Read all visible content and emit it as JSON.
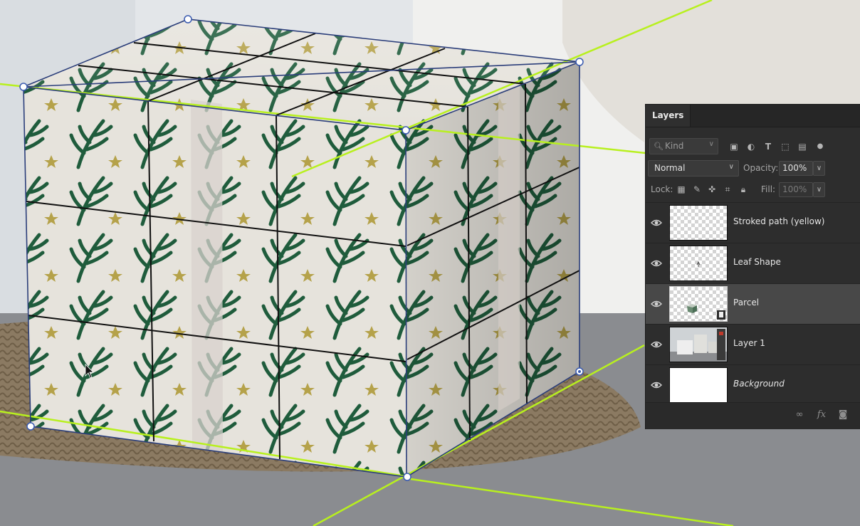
{
  "panel": {
    "title": "Layers",
    "filter": {
      "placeholder": "Kind",
      "icons": [
        "image-filter-icon",
        "adjustment-filter-icon",
        "type-filter-icon",
        "shape-filter-icon",
        "smart-object-filter-icon",
        "filter-toggle-icon"
      ]
    },
    "blend_mode": "Normal",
    "opacity_label": "Opacity:",
    "opacity_value": "100%",
    "lock_label": "Lock:",
    "lock_icons": [
      "lock-transparent-pixels-icon",
      "lock-image-pixels-icon",
      "lock-position-icon",
      "lock-artboard-icon",
      "lock-all-icon"
    ],
    "fill_label": "Fill:",
    "fill_value": "100%",
    "layers": [
      {
        "name": "Stroked path (yellow)",
        "visible": true,
        "selected": false,
        "thumb": "transparent"
      },
      {
        "name": "Leaf Shape",
        "visible": true,
        "selected": false,
        "thumb": "transparent-leaf"
      },
      {
        "name": "Parcel",
        "visible": true,
        "selected": true,
        "thumb": "smart-object-cube"
      },
      {
        "name": "Layer 1",
        "visible": true,
        "selected": false,
        "thumb": "photo"
      },
      {
        "name": "Background",
        "visible": true,
        "selected": false,
        "thumb": "white",
        "italic": true
      }
    ],
    "footer_icons": [
      "link-layers-icon",
      "fx-icon",
      "add-mask-icon"
    ]
  },
  "colors": {
    "guide": "#b8f01e",
    "path": "#2b3e7a",
    "pattern": "#1f5c3c",
    "star": "#b5a24a",
    "panel_bg": "#2d2d2d",
    "selected_bg": "#484848"
  }
}
